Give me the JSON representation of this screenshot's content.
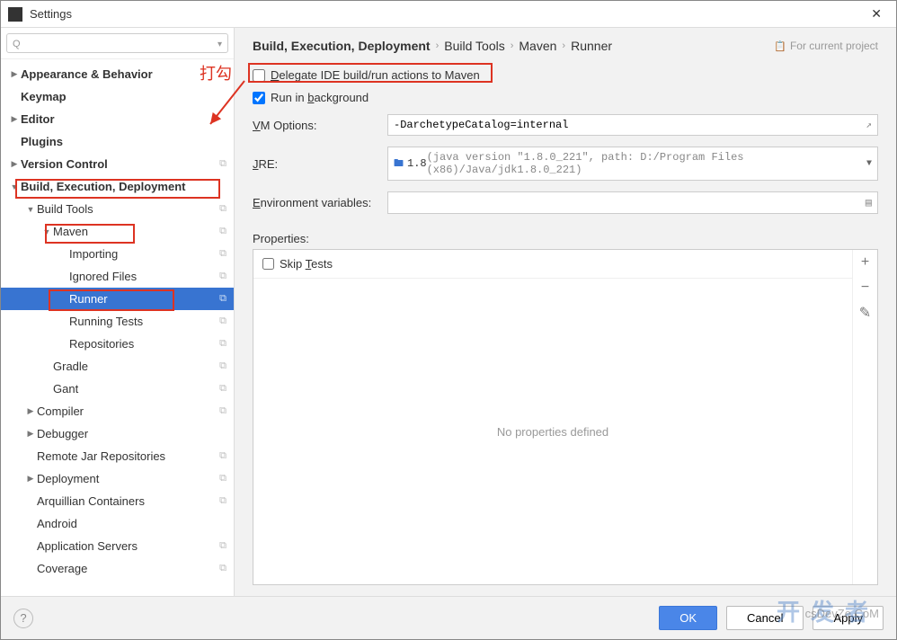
{
  "window": {
    "title": "Settings"
  },
  "search": {
    "placeholder": ""
  },
  "tree": [
    {
      "label": "Appearance & Behavior",
      "bold": true,
      "indent": 0,
      "caret": "▶",
      "badge": ""
    },
    {
      "label": "Keymap",
      "bold": true,
      "indent": 0,
      "caret": "",
      "badge": ""
    },
    {
      "label": "Editor",
      "bold": true,
      "indent": 0,
      "caret": "▶",
      "badge": ""
    },
    {
      "label": "Plugins",
      "bold": true,
      "indent": 0,
      "caret": "",
      "badge": ""
    },
    {
      "label": "Version Control",
      "bold": true,
      "indent": 0,
      "caret": "▶",
      "badge": "⧉"
    },
    {
      "label": "Build, Execution, Deployment",
      "bold": true,
      "indent": 0,
      "caret": "▼",
      "badge": "",
      "redbox": true
    },
    {
      "label": "Build Tools",
      "bold": false,
      "indent": 1,
      "caret": "▼",
      "badge": "⧉"
    },
    {
      "label": "Maven",
      "bold": false,
      "indent": 2,
      "caret": "▼",
      "badge": "⧉",
      "redbox": true
    },
    {
      "label": "Importing",
      "bold": false,
      "indent": 3,
      "caret": "",
      "badge": "⧉"
    },
    {
      "label": "Ignored Files",
      "bold": false,
      "indent": 3,
      "caret": "",
      "badge": "⧉"
    },
    {
      "label": "Runner",
      "bold": false,
      "indent": 3,
      "caret": "",
      "badge": "⧉",
      "selected": true,
      "redbox": true
    },
    {
      "label": "Running Tests",
      "bold": false,
      "indent": 3,
      "caret": "",
      "badge": "⧉"
    },
    {
      "label": "Repositories",
      "bold": false,
      "indent": 3,
      "caret": "",
      "badge": "⧉"
    },
    {
      "label": "Gradle",
      "bold": false,
      "indent": 2,
      "caret": "",
      "badge": "⧉"
    },
    {
      "label": "Gant",
      "bold": false,
      "indent": 2,
      "caret": "",
      "badge": "⧉"
    },
    {
      "label": "Compiler",
      "bold": false,
      "indent": 1,
      "caret": "▶",
      "badge": "⧉"
    },
    {
      "label": "Debugger",
      "bold": false,
      "indent": 1,
      "caret": "▶",
      "badge": ""
    },
    {
      "label": "Remote Jar Repositories",
      "bold": false,
      "indent": 1,
      "caret": "",
      "badge": "⧉"
    },
    {
      "label": "Deployment",
      "bold": false,
      "indent": 1,
      "caret": "▶",
      "badge": "⧉"
    },
    {
      "label": "Arquillian Containers",
      "bold": false,
      "indent": 1,
      "caret": "",
      "badge": "⧉"
    },
    {
      "label": "Android",
      "bold": false,
      "indent": 1,
      "caret": "",
      "badge": ""
    },
    {
      "label": "Application Servers",
      "bold": false,
      "indent": 1,
      "caret": "",
      "badge": "⧉"
    },
    {
      "label": "Coverage",
      "bold": false,
      "indent": 1,
      "caret": "",
      "badge": "⧉"
    }
  ],
  "breadcrumb": [
    "Build, Execution, Deployment",
    "Build Tools",
    "Maven",
    "Runner"
  ],
  "project_hint": "For current project",
  "checks": {
    "delegate": {
      "label_pre": "",
      "underline": "D",
      "label_post": "elegate IDE build/run actions to Maven",
      "checked": false
    },
    "background": {
      "label_pre": "Run in ",
      "underline": "b",
      "label_post": "ackground",
      "checked": true
    }
  },
  "fields": {
    "vm": {
      "label_pre": "",
      "underline": "V",
      "label_post": "M Options:",
      "value": "-DarchetypeCatalog=internal"
    },
    "jre": {
      "label_pre": "",
      "underline": "J",
      "label_post": "RE:",
      "value": "1.8",
      "detail": " (java version \"1.8.0_221\", path: D:/Program Files (x86)/Java/jdk1.8.0_221)"
    },
    "env": {
      "label_pre": "",
      "underline": "E",
      "label_post": "nvironment variables:",
      "value": ""
    }
  },
  "properties": {
    "title": "Properties:",
    "skip": {
      "label_pre": "Skip ",
      "underline": "T",
      "label_post": "ests",
      "checked": false
    },
    "empty": "No properties defined"
  },
  "footer": {
    "ok": "OK",
    "cancel": "Cancel",
    "apply": "Apply"
  },
  "annotation": {
    "text": "打勾"
  },
  "watermark": {
    "main": "开发者",
    "sub": "csDevZe.CoM"
  }
}
